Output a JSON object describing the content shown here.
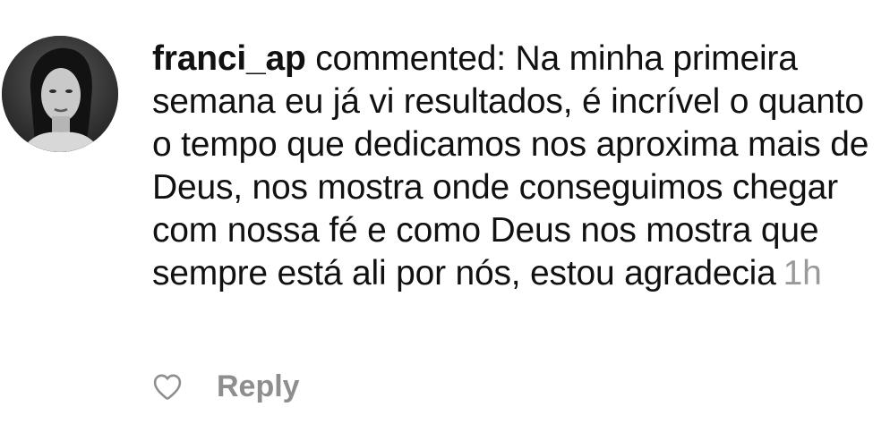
{
  "comment": {
    "username": "franci_ap",
    "verb": " commented: ",
    "text": "Na minha primeira semana eu já vi resultados, é incrível o quanto o tempo que dedicamos nos aproxima mais de Deus, nos mostra onde conseguimos chegar com nossa fé e como Deus nos mostra que sempre está ali por nós, estou agradecia",
    "timestamp": "1h",
    "like_icon": "heart-outline-icon",
    "reply_label": "Reply"
  },
  "colors": {
    "text": "#111111",
    "muted": "#9a9a9a",
    "reply": "#8e8e8e"
  }
}
